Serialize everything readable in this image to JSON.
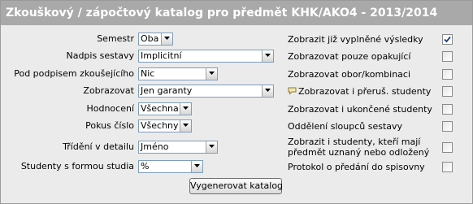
{
  "title": "Zkouškový / zápočtový katalog pro předmět  KHK/AKO4 - 2013/2014",
  "left_fields": [
    {
      "label": "Semestr",
      "value": "Oba"
    },
    {
      "label": "Nadpis sestavy",
      "value": "Implicitní"
    },
    {
      "label": "Pod podpisem zkoušejícího",
      "value": "Nic"
    },
    {
      "label": "Zobrazovat",
      "value": "Jen garanty"
    },
    {
      "label": "Hodnocení",
      "value": "Všechna"
    },
    {
      "label": "Pokus číslo",
      "value": "Všechny"
    },
    {
      "label": "Třídění v detailu",
      "value": "Jméno"
    },
    {
      "label": "Studenty s formou studia",
      "value": "%"
    }
  ],
  "right_options": [
    {
      "label": "Zobrazit již vyplněné výsledky",
      "checked": true
    },
    {
      "label": "Zobrazovat pouze opakující",
      "checked": false
    },
    {
      "label": "Zobrazovat obor/kombinaci",
      "checked": false
    },
    {
      "label": "Zobrazovat i přeruš. studenty",
      "checked": false,
      "icon": "speech-bubble-icon"
    },
    {
      "label": "Zobrazovat i ukončené studenty",
      "checked": false
    },
    {
      "label": "Oddělení sloupců sestavy",
      "checked": false
    },
    {
      "label_line1": "Zobrazit i studenty, kteří mají",
      "label_line2": "předmět uznaný nebo odložený",
      "checked": false
    },
    {
      "label": "Protokol o předání do spisovny",
      "checked": false
    }
  ],
  "generate_button": "Vygenerovat katalog"
}
